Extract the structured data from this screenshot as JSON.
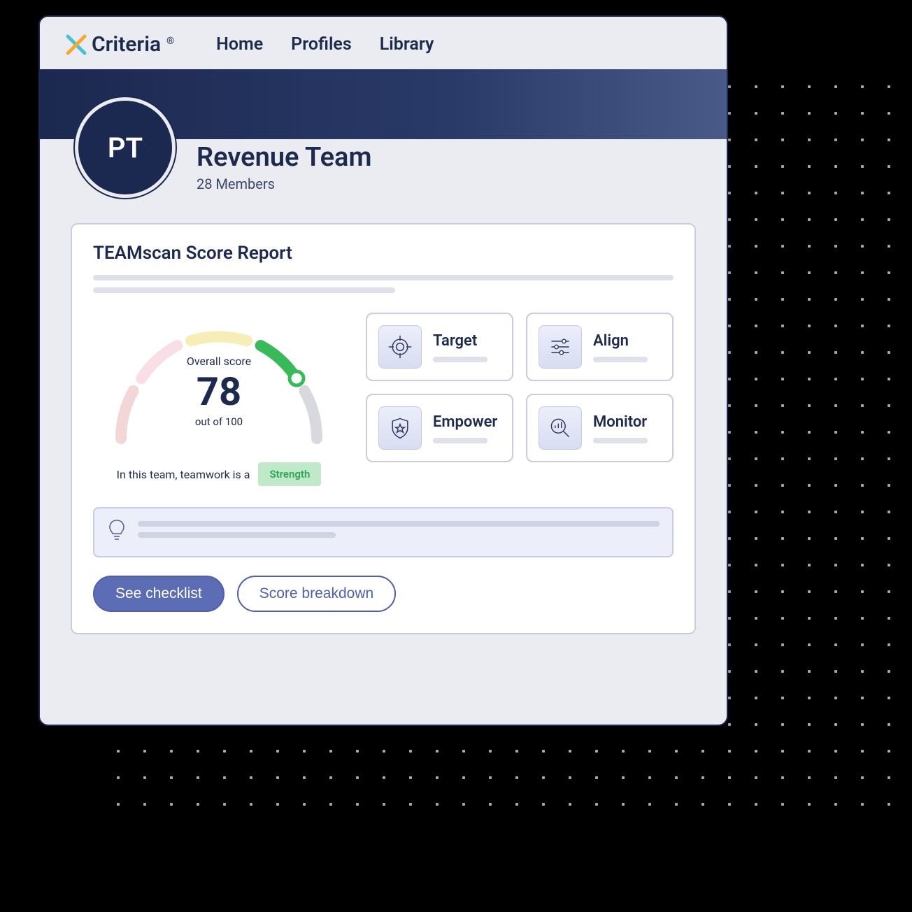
{
  "brand": "Criteria",
  "nav": {
    "home": "Home",
    "profiles": "Profiles",
    "library": "Library"
  },
  "team": {
    "initials": "PT",
    "name": "Revenue Team",
    "members": "28 Members"
  },
  "report": {
    "title": "TEAMscan Score Report",
    "overall_label": "Overall score",
    "score": "78",
    "out_of": "out of 100",
    "strength_lead": "In this team, teamwork is a",
    "strength_tag": "Strength",
    "tiles": [
      {
        "label": "Target",
        "icon": "target-icon"
      },
      {
        "label": "Align",
        "icon": "sliders-icon"
      },
      {
        "label": "Empower",
        "icon": "shield-star-icon"
      },
      {
        "label": "Monitor",
        "icon": "magnify-chart-icon"
      }
    ],
    "buttons": {
      "checklist": "See checklist",
      "breakdown": "Score breakdown"
    }
  },
  "chart_data": {
    "type": "gauge",
    "title": "Overall score",
    "value": 78,
    "max": 100,
    "segments": 5
  }
}
